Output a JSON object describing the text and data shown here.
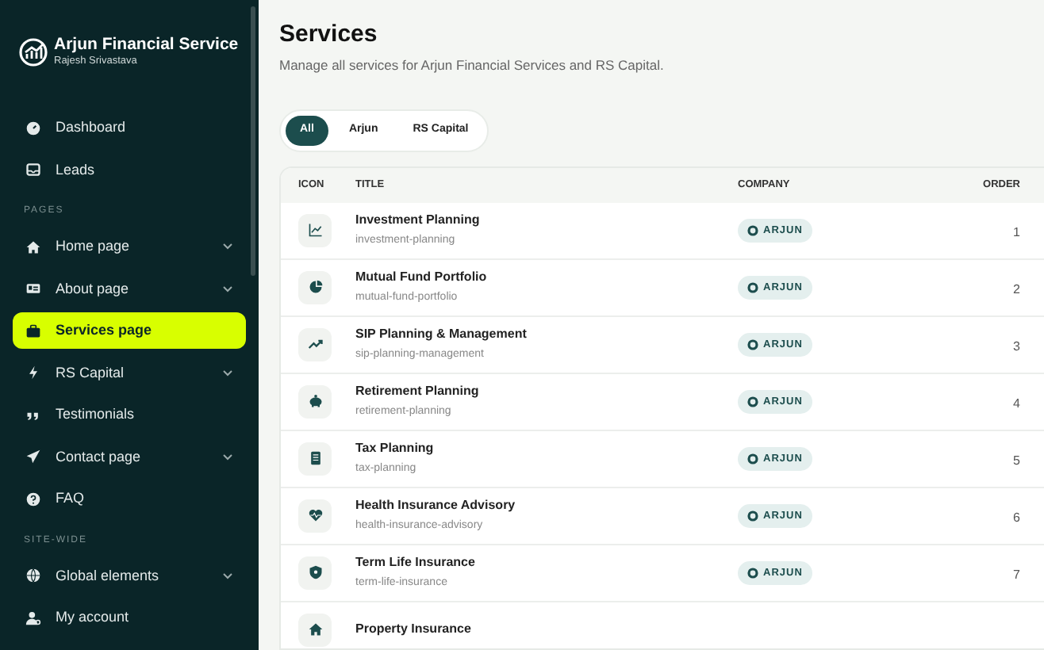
{
  "brand": {
    "title": "Arjun Financial Service",
    "subtitle": "Rajesh Srivastava"
  },
  "sidebar": {
    "sections": [
      {
        "items": [
          {
            "label": "Dashboard",
            "kind": "link",
            "selected": false
          },
          {
            "label": "Leads",
            "kind": "link",
            "selected": false
          }
        ]
      },
      {
        "heading": "PAGES",
        "items": [
          {
            "label": "Home page",
            "kind": "group",
            "selected": false
          },
          {
            "label": "About page",
            "kind": "group",
            "selected": false
          },
          {
            "label": "Services page",
            "kind": "link",
            "selected": true
          },
          {
            "label": "RS Capital",
            "kind": "group",
            "selected": false
          },
          {
            "label": "Testimonials",
            "kind": "link",
            "selected": false
          },
          {
            "label": "Contact page",
            "kind": "group",
            "selected": false
          },
          {
            "label": "FAQ",
            "kind": "link",
            "selected": false
          }
        ]
      },
      {
        "heading": "SITE-WIDE",
        "items": [
          {
            "label": "Global elements",
            "kind": "group",
            "selected": false
          },
          {
            "label": "My account",
            "kind": "link",
            "selected": false
          }
        ]
      }
    ]
  },
  "page": {
    "title": "Services",
    "subtitle": "Manage all services for Arjun Financial Services and RS Capital."
  },
  "filters": [
    {
      "label": "All",
      "selected": true
    },
    {
      "label": "Arjun",
      "selected": false
    },
    {
      "label": "RS Capital",
      "selected": false
    }
  ],
  "table": {
    "columns": [
      "ICON",
      "TITLE",
      "COMPANY",
      "ORDER"
    ],
    "rows": [
      {
        "title": "Investment Planning",
        "slug": "investment-planning",
        "company": "ARJUN",
        "order": "1"
      },
      {
        "title": "Mutual Fund Portfolio",
        "slug": "mutual-fund-portfolio",
        "company": "ARJUN",
        "order": "2"
      },
      {
        "title": "SIP Planning & Management",
        "slug": "sip-planning-management",
        "company": "ARJUN",
        "order": "3"
      },
      {
        "title": "Retirement Planning",
        "slug": "retirement-planning",
        "company": "ARJUN",
        "order": "4"
      },
      {
        "title": "Tax Planning",
        "slug": "tax-planning",
        "company": "ARJUN",
        "order": "5"
      },
      {
        "title": "Health Insurance Advisory",
        "slug": "health-insurance-advisory",
        "company": "ARJUN",
        "order": "6"
      },
      {
        "title": "Term Life Insurance",
        "slug": "term-life-insurance",
        "company": "ARJUN",
        "order": "7"
      },
      {
        "title": "Property Insurance"
      }
    ]
  }
}
